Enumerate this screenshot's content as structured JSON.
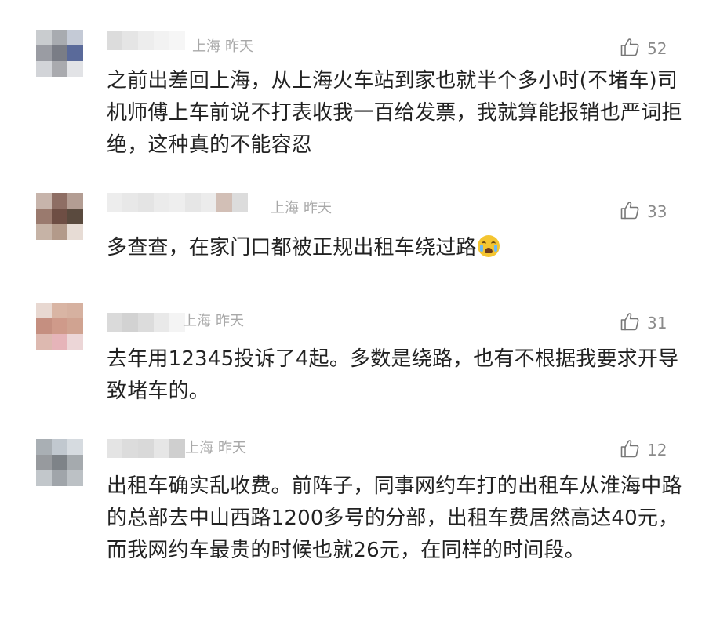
{
  "comments": [
    {
      "location": "上海",
      "time": "昨天",
      "likes": "52",
      "text": "之前出差回上海，从上海火车站到家也就半个多小时(不堵车)司机师傅上车前说不打表收我一百给发票，我就算能报销也严词拒绝，这种真的不能容忍",
      "avatar_colors": [
        "#c9cccf",
        "#a8abb0",
        "#c4cad6",
        "#9a9ca3",
        "#7a7d86",
        "#5a6a9a",
        "#d2d4d8",
        "#a9aaae",
        "#e2e3e6"
      ],
      "name_colors": [
        "#dcdcdc",
        "#e5e5e5",
        "#ededed",
        "#f2f2f2",
        "#f6f6f6"
      ]
    },
    {
      "location": "上海",
      "time": "昨天",
      "likes": "33",
      "text": "多查查，在家门口都被正规出租车绕过路",
      "emoji_name": "crying-face-emoji",
      "avatar_colors": [
        "#c7b4ab",
        "#8e6e64",
        "#b39d93",
        "#9a7a6e",
        "#6e4e44",
        "#5a4a3e",
        "#c6b3a6",
        "#b39a8a",
        "#e7dcd5"
      ],
      "name_colors": [
        "#ededed",
        "#e8e8e8",
        "#e4e4e4",
        "#ebebeb",
        "#eeeeee",
        "#e6e6e6",
        "#ececec",
        "#d2bfb6",
        "#dcdcdc"
      ]
    },
    {
      "location": "上海",
      "time": "昨天",
      "likes": "31",
      "text": "去年用12345投诉了4起。多数是绕路，也有不根据我要求开导致堵车的。",
      "avatar_colors": [
        "#e8d8d1",
        "#d9b5a4",
        "#d6b1a0",
        "#c58f80",
        "#cf9a8a",
        "#d0a391",
        "#ddb9b0",
        "#e6b4b9",
        "#ecd6d7"
      ],
      "name_colors": [
        "#dadada",
        "#d2d2d2",
        "#dcdcdc",
        "#e9e9e9",
        "#f4f4f4"
      ]
    },
    {
      "location": "上海",
      "time": "昨天",
      "likes": "12",
      "text": "出租车确实乱收费。前阵子，同事网约车打的出租车从淮海中路的总部去中山西路1200多号的分部，出租车费居然高达40元，而我网约车最贵的时候也就26元，在同样的时间段。",
      "avatar_colors": [
        "#a9afb4",
        "#c1c8cf",
        "#d6dbe0",
        "#979a9e",
        "#7e8388",
        "#a5aaae",
        "#c2c7cb",
        "#a0a5aa",
        "#bcc1c5"
      ],
      "name_colors": [
        "#e4e4e4",
        "#dcdcdc",
        "#d9d9d9",
        "#e6e6e6",
        "#cfcfcf"
      ]
    }
  ]
}
